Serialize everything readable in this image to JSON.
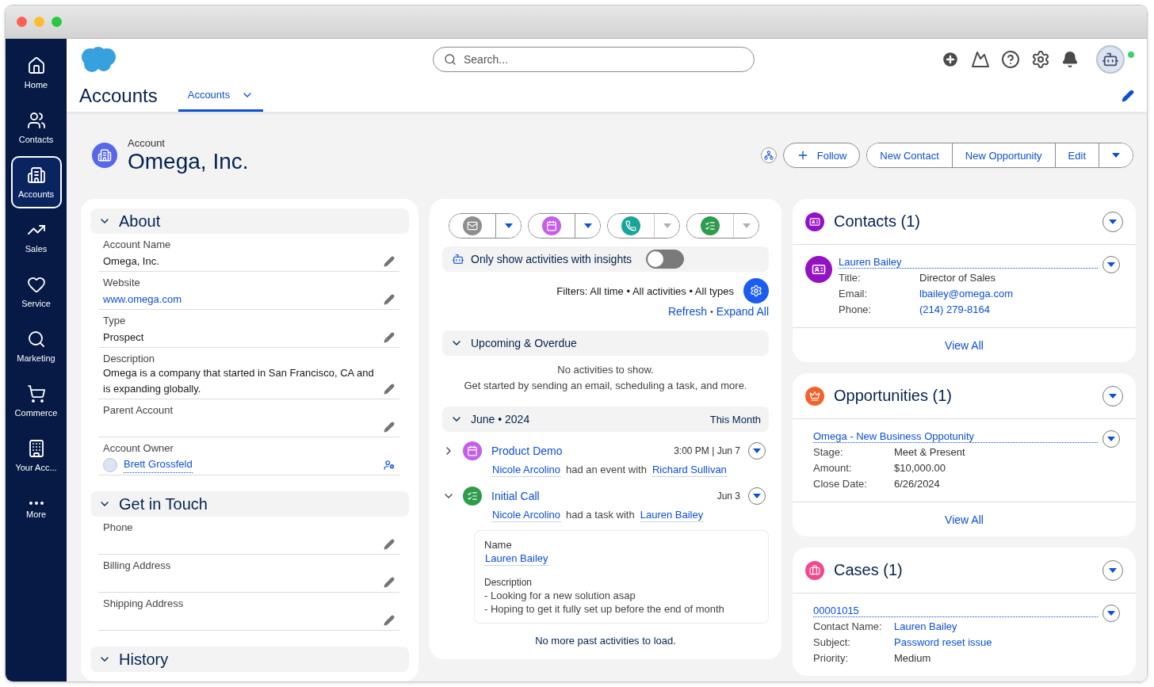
{
  "sidebar": {
    "items": [
      {
        "label": "Home",
        "selected": false
      },
      {
        "label": "Contacts",
        "selected": false
      },
      {
        "label": "Accounts",
        "selected": true
      },
      {
        "label": "Sales",
        "selected": false
      },
      {
        "label": "Service",
        "selected": false
      },
      {
        "label": "Marketing",
        "selected": false
      },
      {
        "label": "Commerce",
        "selected": false
      },
      {
        "label": "Your Acc...",
        "selected": false
      },
      {
        "label": "More",
        "selected": false
      }
    ]
  },
  "header": {
    "search": {
      "placeholder": "Search..."
    },
    "app_title": "Accounts",
    "tabs": [
      {
        "label": "Accounts",
        "selected": true
      }
    ]
  },
  "record": {
    "type_label": "Account",
    "name": "Omega, Inc.",
    "follow": "Follow",
    "actions": [
      "New Contact",
      "New Opportunity",
      "Edit"
    ]
  },
  "details": {
    "sections": [
      {
        "title": "About",
        "expanded": true,
        "fields": [
          {
            "label": "Account Name",
            "value": "Omega, Inc.",
            "kind": "text"
          },
          {
            "label": "Website",
            "value": "www.omega.com",
            "kind": "link"
          },
          {
            "label": "Type",
            "value": "Prospect",
            "kind": "text"
          },
          {
            "label": "Description",
            "value": "Omega is a company that started in San Francisco, CA and is expanding globally.",
            "kind": "text"
          },
          {
            "label": "Parent Account",
            "kind": "text"
          },
          {
            "label": "Account Owner",
            "value": "Brett Grossfeld",
            "kind": "owner"
          }
        ]
      },
      {
        "title": "Get in Touch",
        "expanded": true,
        "fields": [
          {
            "label": "Phone",
            "kind": "text"
          },
          {
            "label": "Billing Address",
            "kind": "text"
          },
          {
            "label": "Shipping Address",
            "kind": "text"
          }
        ]
      },
      {
        "title": "History",
        "expanded": true
      }
    ]
  },
  "activity": {
    "composer": [
      {
        "disabled": false
      },
      {
        "disabled": false
      },
      {
        "disabled": true
      },
      {
        "disabled": true
      }
    ],
    "insights": {
      "label": "Only show activities with insights",
      "on": false
    },
    "filters": "Filters: All time • All activities • All types",
    "links": [
      "Refresh",
      "Expand All"
    ],
    "link_separator": "•",
    "groups": [
      {
        "title": "Upcoming & Overdue",
        "expanded": true,
        "empty_lines": [
          "No activities to show.",
          "Get started by sending an email, scheduling a task, and more."
        ]
      },
      {
        "title": "June • 2024",
        "badge": "This Month",
        "expanded": true,
        "items": [
          {
            "kind": "event",
            "title": "Product Demo",
            "time": "3:00 PM | Jun 7",
            "expanded": false,
            "who": "Nicole Arcolino",
            "verb": "had an event with",
            "whom": "Richard Sullivan"
          },
          {
            "kind": "task",
            "title": "Initial Call",
            "time": "Jun 3",
            "expanded": true,
            "who": "Nicole Arcolino",
            "verb": "had a task with",
            "whom": "Lauren Bailey",
            "details": {
              "name_label": "Name",
              "name": "Lauren Bailey",
              "description_label": "Description",
              "description_lines": [
                "- Looking for a new solution asap",
                "- Hoping to get it fully set up before the end of month"
              ]
            }
          }
        ]
      }
    ],
    "footer": "No more past activities to load."
  },
  "related": [
    {
      "kind": "contact",
      "title": "Contacts (1)",
      "record": {
        "name": "Lauren Bailey",
        "fields": [
          {
            "label": "Title:",
            "value": "Director of Sales",
            "link": false
          },
          {
            "label": "Email:",
            "value": "lbailey@omega.com",
            "link": true
          },
          {
            "label": "Phone:",
            "value": "(214) 279-8164",
            "link": true
          }
        ]
      },
      "view_all": "View All"
    },
    {
      "kind": "opportunity",
      "title": "Opportunities (1)",
      "record": {
        "name": "Omega - New Business Oppotunity",
        "fields": [
          {
            "label": "Stage:",
            "value": "Meet & Present",
            "link": false
          },
          {
            "label": "Amount:",
            "value": "$10,000.00",
            "link": false
          },
          {
            "label": "Close Date:",
            "value": "6/26/2024",
            "link": false
          }
        ]
      },
      "view_all": "View All"
    },
    {
      "kind": "case",
      "title": "Cases (1)",
      "record": {
        "name": "00001015",
        "fields": [
          {
            "label": "Contact Name:",
            "value": "Lauren Bailey",
            "link": true
          },
          {
            "label": "Subject:",
            "value": "Password reset issue",
            "link": true
          },
          {
            "label": "Priority:",
            "value": "Medium",
            "link": false
          }
        ]
      }
    }
  ]
}
